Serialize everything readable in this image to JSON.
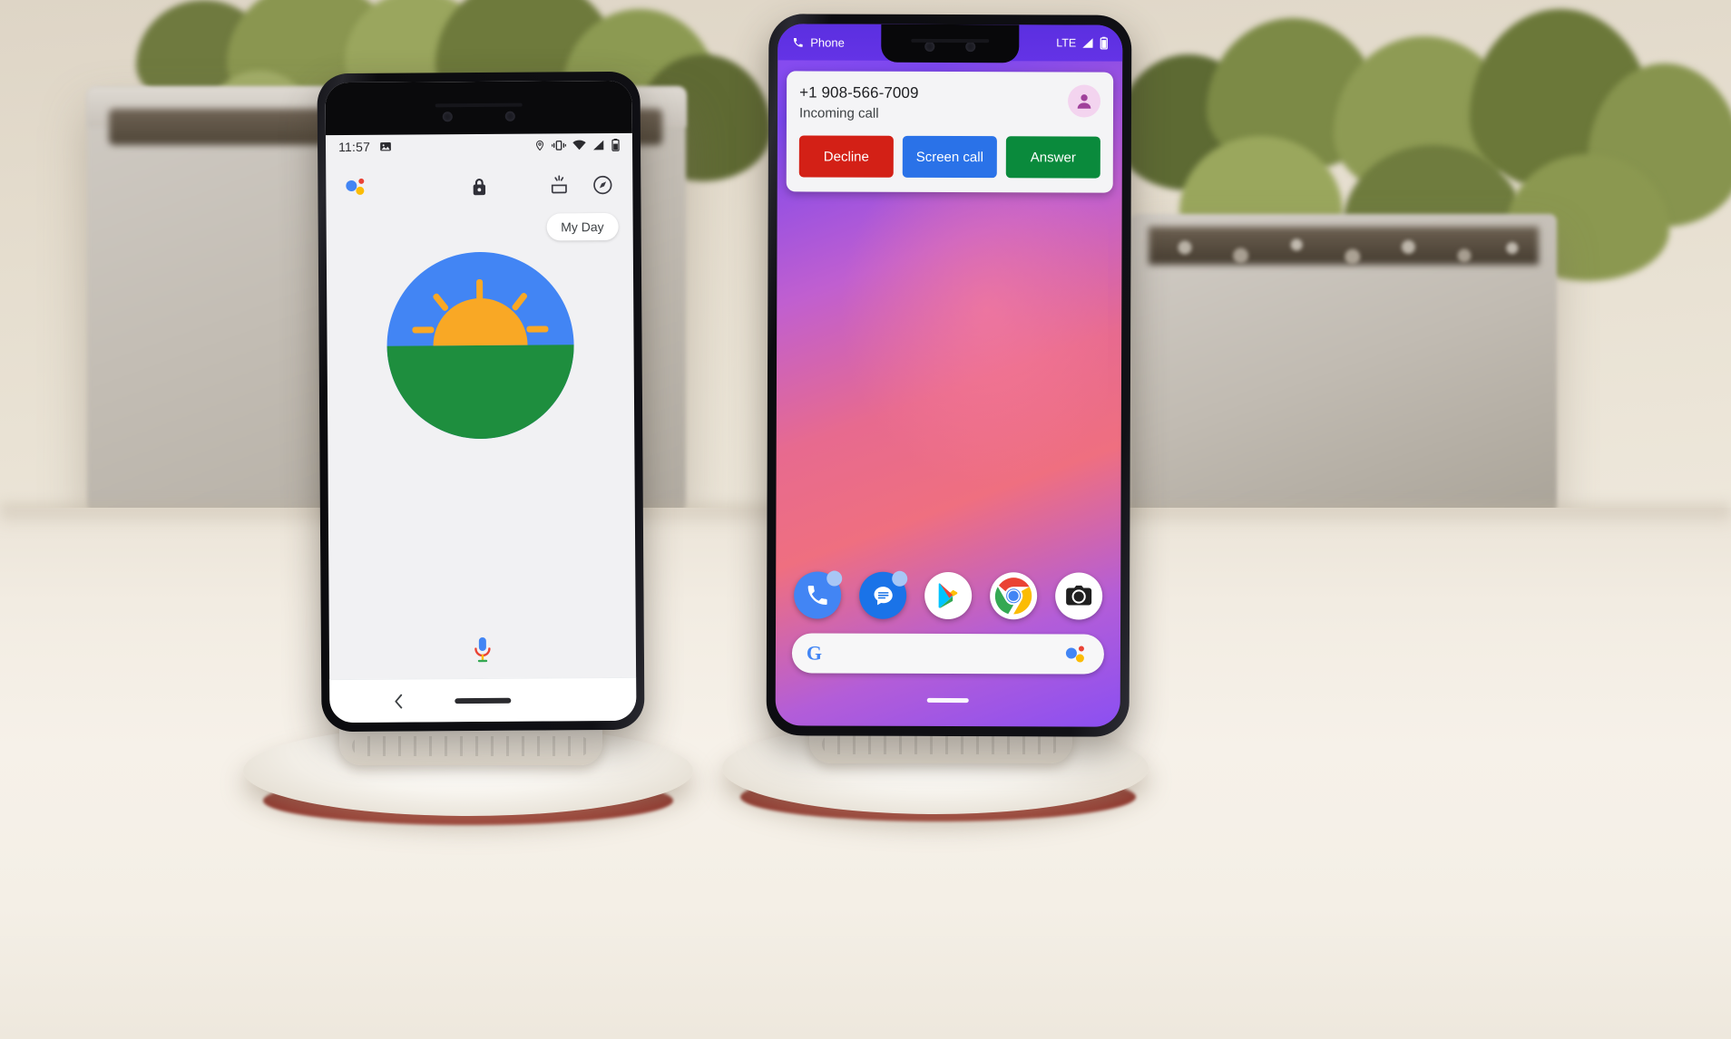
{
  "scene": {
    "description": "Two Google Pixel 3 phones standing on white wireless charging stands on a light desk, potted succulent plants blurred in the background",
    "background_color": "#efe9dd",
    "desk_color": "#f6f1e9"
  },
  "left_phone": {
    "device": "Pixel 3",
    "status_bar": {
      "time": "11:57",
      "left_icons": [
        "image-icon"
      ],
      "right_icons": [
        "location-pin-icon",
        "vibrate-icon",
        "wifi-icon",
        "signal-icon",
        "battery-icon"
      ]
    },
    "assistant_header": {
      "assistant_icon": "google-assistant-dots-icon",
      "lock_icon": "lock-icon",
      "snapshot_icon": "snapshot-inbox-icon",
      "explore_icon": "compass-explore-icon"
    },
    "chip": {
      "label": "My Day"
    },
    "illustration": {
      "name": "sunrise-illustration",
      "sky_color": "#4285f4",
      "ground_color": "#1e8e3e",
      "sun_color": "#f9a825"
    },
    "mic_icon": "microphone-icon",
    "nav_bar": {
      "back_icon": "back-chevron-icon",
      "home_pill": "home-pill-icon"
    }
  },
  "right_phone": {
    "device": "Pixel 3 XL",
    "status_bar": {
      "app_icon": "phone-handset-icon",
      "app_label": "Phone",
      "network": "LTE",
      "right_icons": [
        "signal-icon",
        "battery-icon"
      ]
    },
    "incoming_call": {
      "number": "+1 908-566-7009",
      "status": "Incoming call",
      "avatar_icon": "person-avatar-icon",
      "buttons": [
        {
          "label": "Decline",
          "color": "#d32016",
          "name": "decline-button"
        },
        {
          "label": "Screen call",
          "color": "#2a72e8",
          "name": "screen-call-button"
        },
        {
          "label": "Answer",
          "color": "#0a8a3c",
          "name": "answer-button"
        }
      ]
    },
    "wallpaper": {
      "colors": [
        "#8e4ef0",
        "#c05fd0",
        "#ef6f80",
        "#8b4ff2"
      ]
    },
    "dock": [
      {
        "name": "phone-app-icon",
        "label": "Phone",
        "color": "#4285f4"
      },
      {
        "name": "messages-app-icon",
        "label": "Messages",
        "color": "#1a73e8"
      },
      {
        "name": "play-store-app-icon",
        "label": "Play Store",
        "color": "#ffffff"
      },
      {
        "name": "chrome-app-icon",
        "label": "Chrome",
        "color": "#ffffff"
      },
      {
        "name": "camera-app-icon",
        "label": "Camera",
        "color": "#ffffff"
      }
    ],
    "search_bar": {
      "google_logo": "G",
      "assistant_icon": "google-assistant-dots-icon"
    },
    "home_pill": "home-pill-icon"
  }
}
